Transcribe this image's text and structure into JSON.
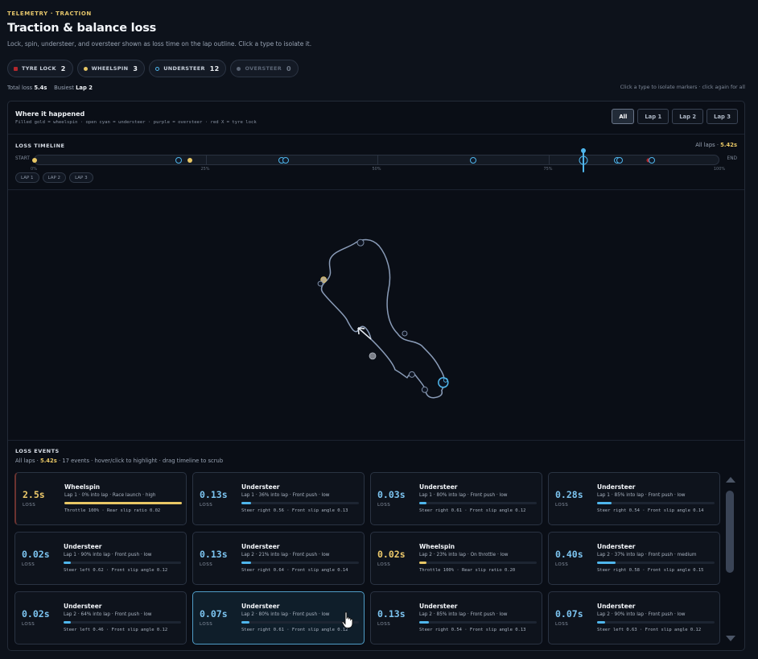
{
  "header": {
    "eyebrow": "TELEMETRY · TRACTION",
    "title": "Traction & balance loss",
    "subtitle": "Lock, spin, understeer, and oversteer shown as loss time on the lap outline. Click a type to isolate it."
  },
  "filters": [
    {
      "label": "TYRE LOCK",
      "count": "2",
      "color": "#b4282d",
      "shape": "square",
      "dim": false
    },
    {
      "label": "WHEELSPIN",
      "count": "3",
      "color": "#e8c765",
      "shape": "dot",
      "dim": false
    },
    {
      "label": "UNDERSTEER",
      "count": "12",
      "color": "#4fb6ec",
      "shape": "ring",
      "dim": false
    },
    {
      "label": "OVERSTEER",
      "count": "0",
      "color": "#5c6676",
      "shape": "dot",
      "dim": true
    }
  ],
  "totals": {
    "total_label": "Total loss",
    "total_value": "5.4s",
    "busiest_label": "Busiest",
    "busiest_value": "Lap 2"
  },
  "hint": "Click a type to isolate markers · click again for all",
  "panel": {
    "title": "Where it happened",
    "legend": "Filled gold = wheelspin · open cyan = understeer · purple = oversteer · red X = tyre lock",
    "lap_buttons": [
      "All",
      "Lap 1",
      "Lap 2",
      "Lap 3"
    ],
    "active_lap": "All"
  },
  "timeline": {
    "label": "LOSS TIMELINE",
    "scope": "All laps",
    "scope_sep": " · ",
    "total": "5.42s",
    "start": "START",
    "end": "END",
    "ticks": [
      "0%",
      "25%",
      "50%",
      "75%",
      "100%"
    ],
    "lap_pills": [
      "LAP 1",
      "LAP 2",
      "LAP 3"
    ],
    "scrub_position": 0.8,
    "markers": [
      {
        "pos": 0.0,
        "type": "ws"
      },
      {
        "pos": 0.21,
        "type": "us"
      },
      {
        "pos": 0.226,
        "type": "ws"
      },
      {
        "pos": 0.36,
        "type": "us"
      },
      {
        "pos": 0.366,
        "type": "us"
      },
      {
        "pos": 0.64,
        "type": "us"
      },
      {
        "pos": 0.8,
        "type": "us",
        "big": true
      },
      {
        "pos": 0.85,
        "type": "us"
      },
      {
        "pos": 0.853,
        "type": "us"
      },
      {
        "pos": 0.896,
        "type": "tl"
      },
      {
        "pos": 0.9,
        "type": "us"
      }
    ]
  },
  "events": {
    "label": "LOSS EVENTS",
    "scope": "All laps",
    "total": "5.42s",
    "tail": "· 17 events · hover/click to highlight · drag timeline to scrub",
    "loss_word": "LOSS",
    "cards": [
      {
        "value": "2.5s",
        "type": "Wheelspin",
        "meta": "Lap 1 · 0% into lap · Race launch · high",
        "detail": "Throttle 100% · Rear slip ratio 0.02",
        "severity": 1.0,
        "kind": "ws",
        "accent": "tl"
      },
      {
        "value": "0.13s",
        "type": "Understeer",
        "meta": "Lap 1 · 36% into lap · Front push · low",
        "detail": "Steer right 0.56 · Front slip angle 0.13",
        "severity": 0.08,
        "kind": "us"
      },
      {
        "value": "0.03s",
        "type": "Understeer",
        "meta": "Lap 1 · 80% into lap · Front push · low",
        "detail": "Steer right 0.61 · Front slip angle 0.12",
        "severity": 0.06,
        "kind": "us"
      },
      {
        "value": "0.28s",
        "type": "Understeer",
        "meta": "Lap 1 · 85% into lap · Front push · low",
        "detail": "Steer right 0.54 · Front slip angle 0.14",
        "severity": 0.12,
        "kind": "us"
      },
      {
        "value": "0.02s",
        "type": "Understeer",
        "meta": "Lap 1 · 90% into lap · Front push · low",
        "detail": "Steer left 0.62 · Front slip angle 0.12",
        "severity": 0.06,
        "kind": "us"
      },
      {
        "value": "0.13s",
        "type": "Understeer",
        "meta": "Lap 2 · 21% into lap · Front push · low",
        "detail": "Steer right 0.64 · Front slip angle 0.14",
        "severity": 0.08,
        "kind": "us"
      },
      {
        "value": "0.02s",
        "type": "Wheelspin",
        "meta": "Lap 2 · 23% into lap · On throttle · low",
        "detail": "Throttle 100% · Rear slip ratio 0.20",
        "severity": 0.06,
        "kind": "ws"
      },
      {
        "value": "0.40s",
        "type": "Understeer",
        "meta": "Lap 2 · 37% into lap · Front push · medium",
        "detail": "Steer right 0.58 · Front slip angle 0.15",
        "severity": 0.16,
        "kind": "us"
      },
      {
        "value": "0.02s",
        "type": "Understeer",
        "meta": "Lap 2 · 64% into lap · Front push · low",
        "detail": "Steer left 0.46 · Front slip angle 0.12",
        "severity": 0.06,
        "kind": "us"
      },
      {
        "value": "0.07s",
        "type": "Understeer",
        "meta": "Lap 2 · 80% into lap · Front push · low",
        "detail": "Steer right 0.61 · Front slip angle 0.12",
        "severity": 0.07,
        "kind": "us",
        "selected": true
      },
      {
        "value": "0.13s",
        "type": "Understeer",
        "meta": "Lap 2 · 85% into lap · Front push · low",
        "detail": "Steer right 0.54 · Front slip angle 0.13",
        "severity": 0.08,
        "kind": "us"
      },
      {
        "value": "0.07s",
        "type": "Understeer",
        "meta": "Lap 2 · 90% into lap · Front push · low",
        "detail": "Steer left 0.63 · Front slip angle 0.12",
        "severity": 0.07,
        "kind": "us"
      }
    ]
  }
}
